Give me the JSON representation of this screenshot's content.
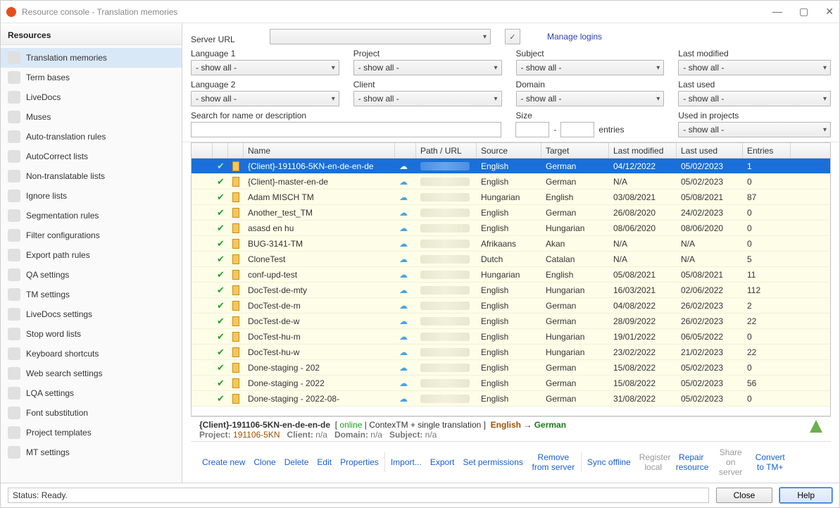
{
  "window": {
    "title": "Resource console - Translation memories"
  },
  "sidebar": {
    "header": "Resources",
    "items": [
      {
        "label": "Translation memories",
        "active": true,
        "icon": "tm-icon"
      },
      {
        "label": "Term bases",
        "icon": "termbase-icon"
      },
      {
        "label": "LiveDocs",
        "icon": "livedocs-icon"
      },
      {
        "label": "Muses",
        "icon": "muses-icon"
      },
      {
        "label": "Auto-translation rules",
        "icon": "autotrans-icon"
      },
      {
        "label": "AutoCorrect lists",
        "icon": "autocorrect-icon"
      },
      {
        "label": "Non-translatable lists",
        "icon": "nontrans-icon"
      },
      {
        "label": "Ignore lists",
        "icon": "ignore-icon"
      },
      {
        "label": "Segmentation rules",
        "icon": "segmentation-icon"
      },
      {
        "label": "Filter configurations",
        "icon": "filterconfig-icon"
      },
      {
        "label": "Export path rules",
        "icon": "exportpath-icon"
      },
      {
        "label": "QA settings",
        "icon": "qa-icon"
      },
      {
        "label": "TM settings",
        "icon": "tmsettings-icon"
      },
      {
        "label": "LiveDocs settings",
        "icon": "livedocssettings-icon"
      },
      {
        "label": "Stop word lists",
        "icon": "stopwords-icon"
      },
      {
        "label": "Keyboard shortcuts",
        "icon": "keyboard-icon"
      },
      {
        "label": "Web search settings",
        "icon": "websearch-icon"
      },
      {
        "label": "LQA settings",
        "icon": "lqa-icon"
      },
      {
        "label": "Font substitution",
        "icon": "font-icon"
      },
      {
        "label": "Project templates",
        "icon": "projecttpl-icon"
      },
      {
        "label": "MT settings",
        "icon": "mt-icon"
      }
    ]
  },
  "filters": {
    "serverUrl": {
      "label": "Server URL",
      "value": ""
    },
    "manageLogins": "Manage logins",
    "lang1": {
      "label": "Language 1",
      "value": "- show all -"
    },
    "project": {
      "label": "Project",
      "value": "- show all -"
    },
    "subject": {
      "label": "Subject",
      "value": "- show all -"
    },
    "lastModified": {
      "label": "Last modified",
      "value": "- show all -"
    },
    "lang2": {
      "label": "Language 2",
      "value": "- show all -"
    },
    "client": {
      "label": "Client",
      "value": "- show all -"
    },
    "domain": {
      "label": "Domain",
      "value": "- show all -"
    },
    "lastUsed": {
      "label": "Last used",
      "value": "- show all -"
    },
    "search": {
      "label": "Search for name or description",
      "value": ""
    },
    "size": {
      "label": "Size",
      "from": "",
      "to": "",
      "suffix": "entries"
    },
    "usedInProjects": {
      "label": "Used in projects",
      "value": "- show all -"
    }
  },
  "grid": {
    "headers": {
      "name": "Name",
      "path": "Path / URL",
      "source": "Source",
      "target": "Target",
      "modified": "Last modified",
      "used": "Last used",
      "entries": "Entries"
    },
    "rows": [
      {
        "name": "{Client}-191106-5KN-en-de-en-de",
        "source": "English",
        "target": "German",
        "modified": "04/12/2022",
        "used": "05/02/2023",
        "entries": "1",
        "selected": true
      },
      {
        "name": "{Client}-master-en-de",
        "source": "English",
        "target": "German",
        "modified": "N/A",
        "used": "05/02/2023",
        "entries": "0"
      },
      {
        "name": "Adam MISCH TM",
        "source": "Hungarian",
        "target": "English",
        "modified": "03/08/2021",
        "used": "05/08/2021",
        "entries": "87"
      },
      {
        "name": "Another_test_TM",
        "source": "English",
        "target": "German",
        "modified": "26/08/2020",
        "used": "24/02/2023",
        "entries": "0"
      },
      {
        "name": "asasd en hu",
        "source": "English",
        "target": "Hungarian",
        "modified": "08/06/2020",
        "used": "08/06/2020",
        "entries": "0"
      },
      {
        "name": "BUG-3141-TM",
        "source": "Afrikaans",
        "target": "Akan",
        "modified": "N/A",
        "used": "N/A",
        "entries": "0"
      },
      {
        "name": "CloneTest",
        "source": "Dutch",
        "target": "Catalan",
        "modified": "N/A",
        "used": "N/A",
        "entries": "5"
      },
      {
        "name": "conf-upd-test",
        "source": "Hungarian",
        "target": "English",
        "modified": "05/08/2021",
        "used": "05/08/2021",
        "entries": "11"
      },
      {
        "name": "DocTest-de-mty",
        "source": "English",
        "target": "Hungarian",
        "modified": "16/03/2021",
        "used": "02/06/2022",
        "entries": "112"
      },
      {
        "name": "DocTest-de-m",
        "source": "English",
        "target": "German",
        "modified": "04/08/2022",
        "used": "26/02/2023",
        "entries": "2"
      },
      {
        "name": "DocTest-de-w",
        "source": "English",
        "target": "German",
        "modified": "28/09/2022",
        "used": "26/02/2023",
        "entries": "22"
      },
      {
        "name": "DocTest-hu-m",
        "source": "English",
        "target": "Hungarian",
        "modified": "19/01/2022",
        "used": "06/05/2022",
        "entries": "0"
      },
      {
        "name": "DocTest-hu-w",
        "source": "English",
        "target": "Hungarian",
        "modified": "23/02/2022",
        "used": "21/02/2023",
        "entries": "22"
      },
      {
        "name": "Done-staging - 202",
        "source": "English",
        "target": "German",
        "modified": "15/08/2022",
        "used": "05/02/2023",
        "entries": "0"
      },
      {
        "name": "Done-staging - 2022",
        "source": "English",
        "target": "German",
        "modified": "15/08/2022",
        "used": "05/02/2023",
        "entries": "56"
      },
      {
        "name": "Done-staging - 2022-08-",
        "source": "English",
        "target": "German",
        "modified": "31/08/2022",
        "used": "05/02/2023",
        "entries": "0"
      }
    ]
  },
  "detail": {
    "name": "{Client}-191106-5KN-en-de-en-de",
    "status": "online",
    "meta": "ContexTM + single translation",
    "source": "English",
    "arrow": "→",
    "target": "German",
    "line2_a": "Project:",
    "line2_av": "191106-5KN",
    "line2_b": "Client:",
    "line2_bv": "n/a",
    "line2_c": "Domain:",
    "line2_cv": "n/a",
    "line2_d": "Subject:",
    "line2_dv": "n/a"
  },
  "actions": {
    "createNew": "Create new",
    "clone": "Clone",
    "delete": "Delete",
    "edit": "Edit",
    "properties": "Properties",
    "import": "Import...",
    "export": "Export",
    "setPermissions": "Set permissions",
    "removeFromServer": "Remove from server",
    "syncOffline": "Sync offline",
    "registerLocal": "Register local",
    "repairResource": "Repair resource",
    "shareOnServer": "Share on server",
    "convertToTmPlus": "Convert to TM+"
  },
  "statusbar": {
    "status": "Status: Ready.",
    "close": "Close",
    "help": "Help"
  }
}
